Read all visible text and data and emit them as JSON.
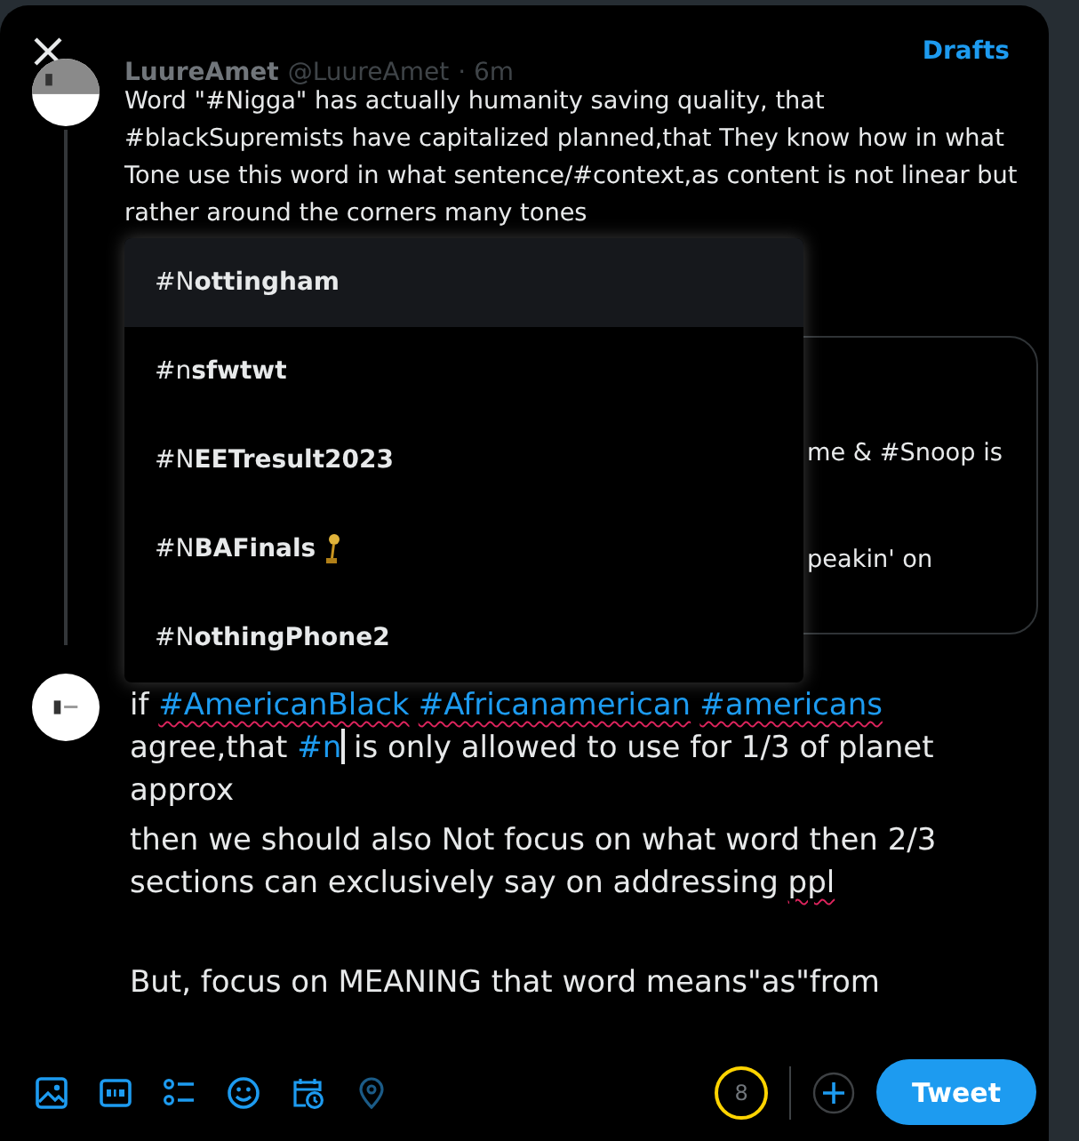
{
  "header": {
    "drafts": "Drafts"
  },
  "parent_tweet": {
    "name": "LuureAmet",
    "handle": "@LuureAmet",
    "time": "· 6m",
    "text": "Word \"#Nigga\" has actually humanity saving quality, that #blackSupremists have capitalized planned,that  They know how in what Tone use this word in what sentence/#context,as content is not linear but rather around the corners many tones"
  },
  "quoted_tweet": {
    "lines": [
      "me & #Snoop is",
      "peakin' on"
    ]
  },
  "suggestions": [
    {
      "label": "#N**ottingham**",
      "selected": true,
      "trophy": false
    },
    {
      "label": "#n**sfwtwt**",
      "selected": false,
      "trophy": false
    },
    {
      "label": "#N**EETresult2023**",
      "selected": false,
      "trophy": false
    },
    {
      "label": "#N**BAFinals**",
      "selected": false,
      "trophy": true
    },
    {
      "label": "#N**othingPhone2**",
      "selected": false,
      "trophy": false
    }
  ],
  "compose": {
    "paragraphs": [
      {
        "gap_before": false,
        "segments": [
          {
            "kind": "text",
            "text": "if "
          },
          {
            "kind": "hashtag",
            "text": "#AmericanBlack",
            "misspelled": true,
            "space_after": true
          },
          {
            "kind": "hashtag",
            "text": "#Africanamerican",
            "misspelled": true,
            "space_after": true
          },
          {
            "kind": "hashtag",
            "text": "#americans",
            "misspelled": true
          },
          {
            "kind": "text",
            "text": " agree,that "
          },
          {
            "kind": "hashtag",
            "text": "#n",
            "caret": true
          },
          {
            "kind": "text",
            "text": " is only allowed to use for 1/3 of planet approx"
          }
        ]
      },
      {
        "gap_before": false,
        "segments": [
          {
            "kind": "text",
            "text": "then we should also Not focus on what word then 2/3 sections can exclusively say on addressing "
          },
          {
            "kind": "text",
            "text": "ppl",
            "misspelled": true
          }
        ]
      },
      {
        "gap_before": true,
        "segments": [
          {
            "kind": "text",
            "text": "But, focus on MEANING that word means\"as\"from"
          }
        ]
      }
    ]
  },
  "footer": {
    "counter": "8",
    "tweet_button": "Tweet"
  }
}
